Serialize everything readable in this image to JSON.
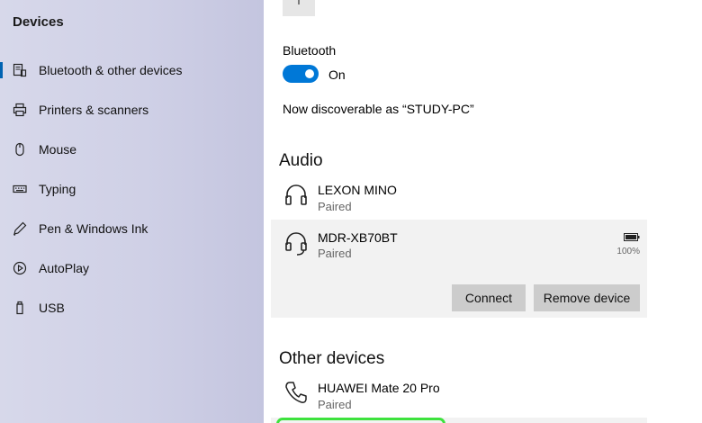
{
  "sidebar": {
    "title": "Devices",
    "items": [
      {
        "label": "Bluetooth & other devices",
        "icon": "bluetooth-devices-icon",
        "active": true
      },
      {
        "label": "Printers & scanners",
        "icon": "printer-icon"
      },
      {
        "label": "Mouse",
        "icon": "mouse-icon"
      },
      {
        "label": "Typing",
        "icon": "keyboard-icon"
      },
      {
        "label": "Pen & Windows Ink",
        "icon": "pen-icon"
      },
      {
        "label": "AutoPlay",
        "icon": "autoplay-icon"
      },
      {
        "label": "USB",
        "icon": "usb-icon"
      }
    ]
  },
  "bluetooth": {
    "label": "Bluetooth",
    "state": "On",
    "on": true,
    "discoverable": "Now discoverable as “STUDY-PC”"
  },
  "audio": {
    "heading": "Audio",
    "devices": [
      {
        "name": "LEXON MINO",
        "status": "Paired",
        "icon": "headphones-icon"
      },
      {
        "name": "MDR-XB70BT",
        "status": "Paired",
        "icon": "headphones-icon",
        "battery": "100%",
        "selected": true
      }
    ],
    "connect_label": "Connect",
    "remove_label": "Remove device"
  },
  "other": {
    "heading": "Other devices",
    "devices": [
      {
        "name": "HUAWEI Mate 20 Pro",
        "status": "Paired",
        "icon": "phone-icon"
      }
    ]
  },
  "colors": {
    "accent": "#0078d7",
    "highlight": "#3ee23e"
  }
}
